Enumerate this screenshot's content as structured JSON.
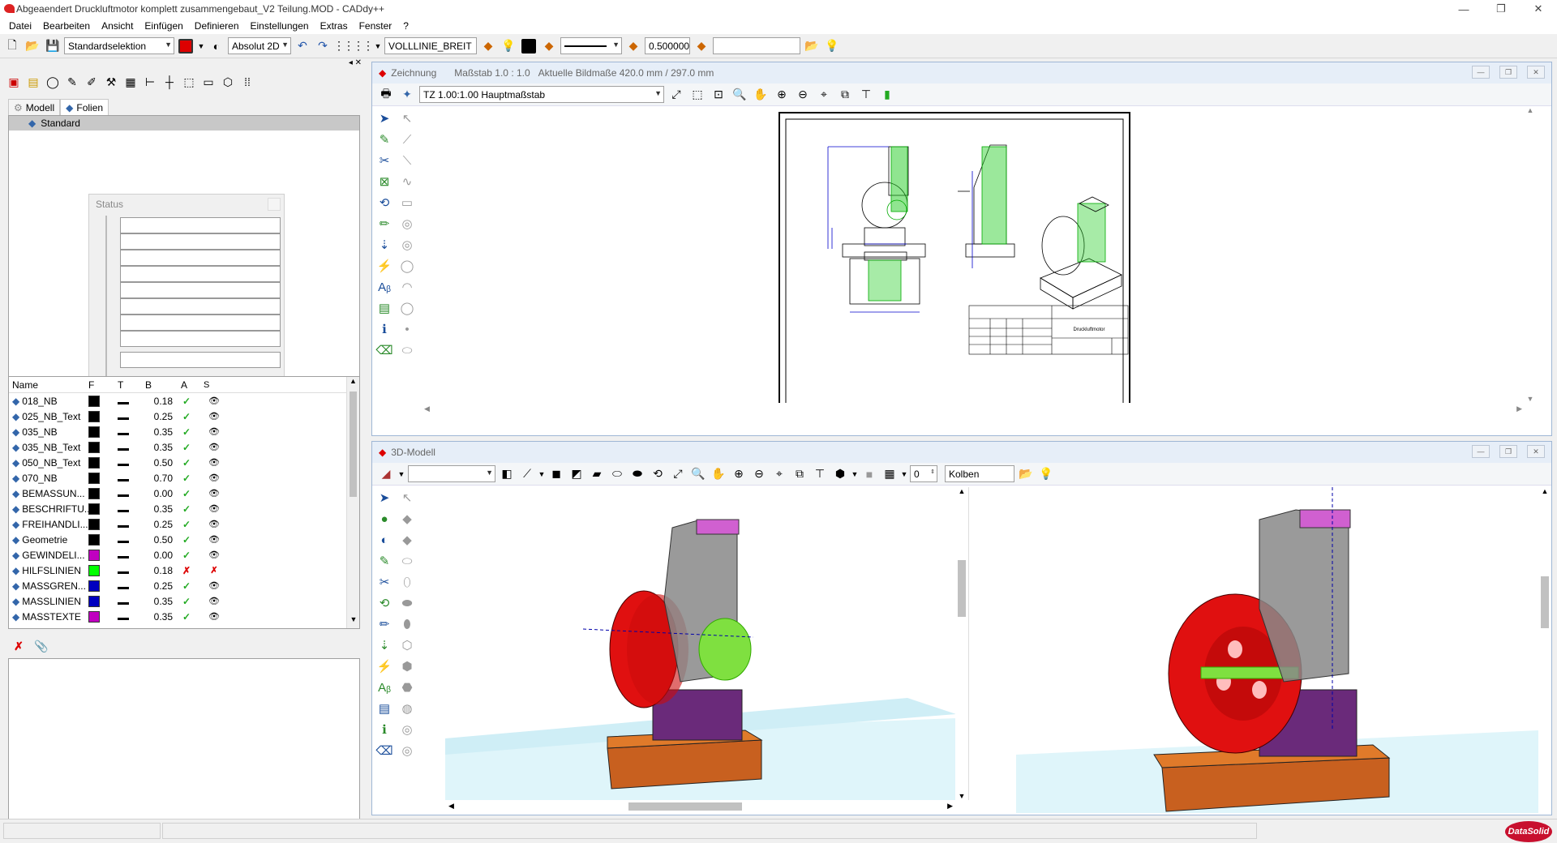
{
  "window": {
    "title": "Abgeaendert Druckluftmotor komplett zusammengebaut_V2 Teilung.MOD  -  CADdy++"
  },
  "menu": [
    "Datei",
    "Bearbeiten",
    "Ansicht",
    "Einfügen",
    "Definieren",
    "Einstellungen",
    "Extras",
    "Fenster",
    "?"
  ],
  "toolbar": {
    "selection_mode": "Standardselektion",
    "coord_mode": "Absolut 2D",
    "linetype": "VOLLLINIE_BREIT",
    "line_width": "0.500000",
    "text_field": ""
  },
  "left": {
    "tabs": [
      "Modell",
      "Folien"
    ],
    "tree_root": "Standard",
    "status_title": "Status",
    "layer_headers": [
      "Name",
      "F",
      "T",
      "B",
      "A",
      "S"
    ],
    "layers": [
      {
        "name": "018_NB",
        "color": "#000000",
        "width": "0.18",
        "a": "✓",
        "s": "👁",
        "ac": "#2a2"
      },
      {
        "name": "025_NB_Text",
        "color": "#000000",
        "width": "0.25",
        "a": "✓",
        "s": "👁",
        "ac": "#2a2"
      },
      {
        "name": "035_NB",
        "color": "#000000",
        "width": "0.35",
        "a": "✓",
        "s": "👁",
        "ac": "#2a2"
      },
      {
        "name": "035_NB_Text",
        "color": "#000000",
        "width": "0.35",
        "a": "✓",
        "s": "👁",
        "ac": "#2a2"
      },
      {
        "name": "050_NB_Text",
        "color": "#000000",
        "width": "0.50",
        "a": "✓",
        "s": "👁",
        "ac": "#2a2"
      },
      {
        "name": "070_NB",
        "color": "#000000",
        "width": "0.70",
        "a": "✓",
        "s": "👁",
        "ac": "#2a2"
      },
      {
        "name": "BEMASSUN...",
        "color": "#000000",
        "width": "0.00",
        "a": "✓",
        "s": "👁",
        "ac": "#2a2"
      },
      {
        "name": "BESCHRIFTU...",
        "color": "#000000",
        "width": "0.35",
        "a": "✓",
        "s": "👁",
        "ac": "#2a2"
      },
      {
        "name": "FREIHANDLI...",
        "color": "#000000",
        "width": "0.25",
        "a": "✓",
        "s": "👁",
        "ac": "#2a2"
      },
      {
        "name": "Geometrie",
        "color": "#000000",
        "width": "0.50",
        "a": "✓",
        "s": "👁",
        "ac": "#2a2"
      },
      {
        "name": "GEWINDELI...",
        "color": "#c000c0",
        "width": "0.00",
        "a": "✓",
        "s": "👁",
        "ac": "#2a2"
      },
      {
        "name": "HILFSLINIEN",
        "color": "#00ff00",
        "width": "0.18",
        "a": "✗",
        "s": "✗",
        "ac": "#d00"
      },
      {
        "name": "MASSGREN...",
        "color": "#0000c0",
        "width": "0.25",
        "a": "✓",
        "s": "👁",
        "ac": "#2a2"
      },
      {
        "name": "MASSLINIEN",
        "color": "#0000c0",
        "width": "0.35",
        "a": "✓",
        "s": "👁",
        "ac": "#2a2"
      },
      {
        "name": "MASSTEXTE",
        "color": "#c000c0",
        "width": "0.35",
        "a": "✓",
        "s": "👁",
        "ac": "#2a2"
      }
    ]
  },
  "drawing": {
    "title": "Zeichnung",
    "scale": "Maßstab 1.0 : 1.0",
    "size": "Aktuelle Bildmaße 420.0 mm / 297.0 mm",
    "view_combo": "TZ 1.00:1.00 Hauptmaßstab",
    "titleblock_name": "Druckluftmotor"
  },
  "model3d": {
    "title": "3D-Modell",
    "level_value": "0",
    "part_name": "Kolben"
  },
  "brand": "DataSolid"
}
